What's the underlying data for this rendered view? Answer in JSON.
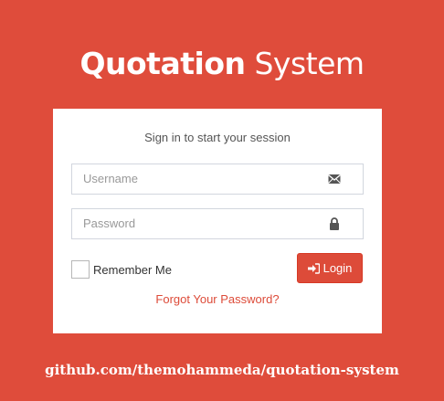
{
  "brand": {
    "bold": "Quotation",
    "light": " System"
  },
  "login_box": {
    "message": "Sign in to start your session",
    "username_placeholder": "Username",
    "password_placeholder": "Password",
    "remember_label": "Remember Me",
    "login_label": "Login",
    "forgot_label": "Forgot Your Password?"
  },
  "icons": {
    "username": "envelope-icon",
    "password": "lock-icon",
    "login": "sign-in-icon"
  },
  "colors": {
    "background": "#df4c3b",
    "button": "#dd4b39",
    "link": "#dd4b39"
  },
  "footer": {
    "text": "github.com/themohammeda/quotation-system"
  }
}
